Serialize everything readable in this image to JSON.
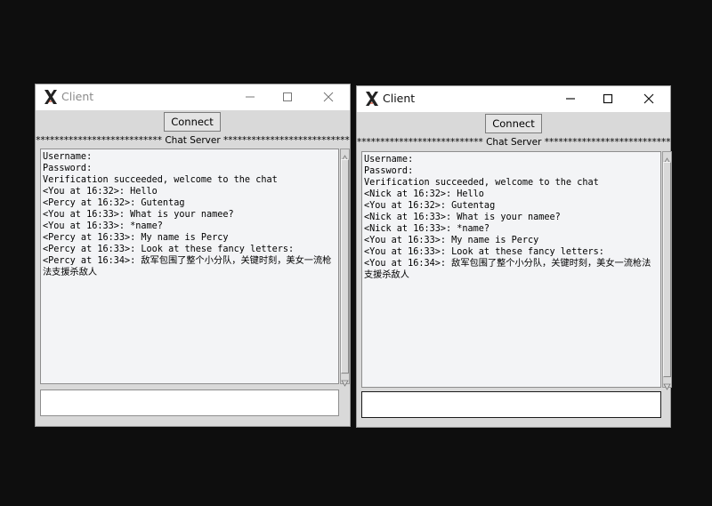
{
  "windows": [
    {
      "title": "Client",
      "connect_label": "Connect",
      "banner": "*************************** Chat Server ***************************",
      "log_lines": [
        "Username:",
        "Password:",
        "Verification succeeded, welcome to the chat",
        "<You at 16:32>: Hello",
        "<Percy at 16:32>: Gutentag",
        "<You at 16:33>: What is your namee?",
        "<You at 16:33>: *name?",
        "<Percy at 16:33>: My name is Percy",
        "<Percy at 16:33>: Look at these fancy letters:",
        "<Percy at 16:34>: 敌军包围了整个小分队，关键时刻，美女一流枪法支援杀敌人"
      ],
      "input_value": "",
      "focused": false
    },
    {
      "title": "Client",
      "connect_label": "Connect",
      "banner": "*************************** Chat Server ***************************",
      "log_lines": [
        "Username:",
        "Password:",
        "Verification succeeded, welcome to the chat",
        "<Nick at 16:32>: Hello",
        "<You at 16:32>: Gutentag",
        "<Nick at 16:33>: What is your namee?",
        "<Nick at 16:33>: *name?",
        "<You at 16:33>: My name is Percy",
        "<You at 16:33>: Look at these fancy letters:",
        "<You at 16:34>: 敌军包围了整个小分队，关键时刻，美女一流枪法支援杀敌人"
      ],
      "input_value": "",
      "focused": true
    }
  ]
}
